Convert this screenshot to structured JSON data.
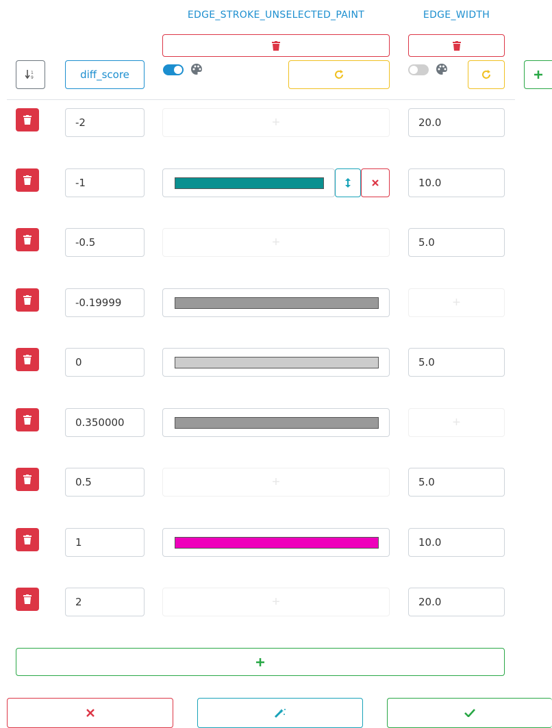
{
  "columns": {
    "key": "diff_score",
    "stroke": "EDGE_STROKE_UNSELECTED_PAINT",
    "width": "EDGE_WIDTH"
  },
  "icons": {
    "sort": "sort-numeric-icon",
    "trash": "trash-icon",
    "palette": "palette-icon",
    "redo": "redo-icon",
    "plus": "plus-icon",
    "resize": "vertical-arrows-icon",
    "close": "times-icon",
    "magic": "magic-wand-icon",
    "check": "check-icon"
  },
  "colors": {
    "accent_blue": "#1b8ecf",
    "danger": "#dc3545",
    "warning": "#f0c020",
    "success": "#28a745",
    "info": "#17a2b8"
  },
  "toggles": {
    "stroke_enabled": true,
    "width_enabled": false
  },
  "rows": [
    {
      "key": "-2",
      "stroke": null,
      "width": "20.0"
    },
    {
      "key": "-1",
      "stroke": "#0a9090",
      "width": "10.0",
      "editing": true
    },
    {
      "key": "-0.5",
      "stroke": null,
      "width": "5.0"
    },
    {
      "key": "-0.19999",
      "stroke": "#999999",
      "width": null
    },
    {
      "key": "0",
      "stroke": "#cccccc",
      "width": "5.0"
    },
    {
      "key": "0.350000",
      "stroke": "#999999",
      "width": null
    },
    {
      "key": "0.5",
      "stroke": null,
      "width": "5.0"
    },
    {
      "key": "1",
      "stroke": "#ee00bb",
      "width": "10.0"
    },
    {
      "key": "2",
      "stroke": null,
      "width": "20.0"
    }
  ]
}
